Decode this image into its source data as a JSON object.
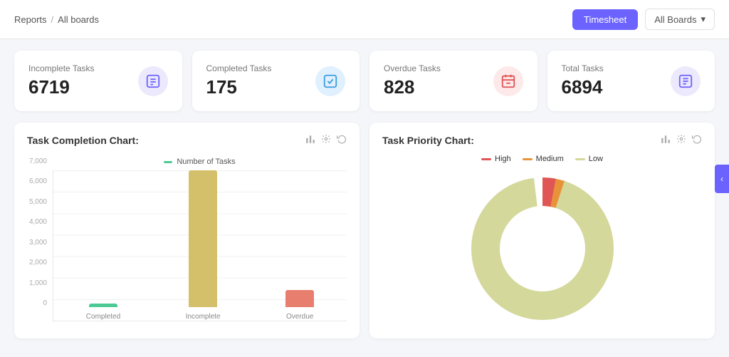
{
  "header": {
    "breadcrumb_root": "Reports",
    "breadcrumb_sep": "/",
    "breadcrumb_child": "All boards",
    "timesheet_label": "Timesheet",
    "boards_dropdown": "All Boards"
  },
  "stats": [
    {
      "label": "Incomplete Tasks",
      "value": "6719",
      "icon": "📋",
      "icon_class": "purple"
    },
    {
      "label": "Completed Tasks",
      "value": "175",
      "icon": "✅",
      "icon_class": "blue"
    },
    {
      "label": "Overdue Tasks",
      "value": "828",
      "icon": "📅",
      "icon_class": "red"
    },
    {
      "label": "Total Tasks",
      "value": "6894",
      "icon": "📊",
      "icon_class": "purple2"
    }
  ],
  "completion_chart": {
    "title": "Task Completion Chart:",
    "legend_label": "Number of Tasks",
    "legend_color": "#4dc994",
    "y_labels": [
      "7,000",
      "6,000",
      "5,000",
      "4,000",
      "3,000",
      "2,000",
      "1,000",
      "0"
    ],
    "bars": [
      {
        "label": "Completed",
        "value": 175,
        "max": 7000,
        "color": "#4dc994"
      },
      {
        "label": "Incomplete",
        "value": 6719,
        "max": 7000,
        "color": "#d4c06a"
      },
      {
        "label": "Overdue",
        "value": 828,
        "max": 7000,
        "color": "#e87e6e"
      }
    ]
  },
  "priority_chart": {
    "title": "Task Priority Chart:",
    "legend": [
      {
        "label": "High",
        "color": "#e05555"
      },
      {
        "label": "Medium",
        "color": "#e8933a"
      },
      {
        "label": "Low",
        "color": "#d4d89a"
      }
    ],
    "donut": {
      "high_pct": 3,
      "medium_pct": 4,
      "low_pct": 93,
      "high_color": "#e05555",
      "medium_color": "#e8933a",
      "low_color": "#d4d89a"
    }
  },
  "sidebar_toggle": "‹"
}
